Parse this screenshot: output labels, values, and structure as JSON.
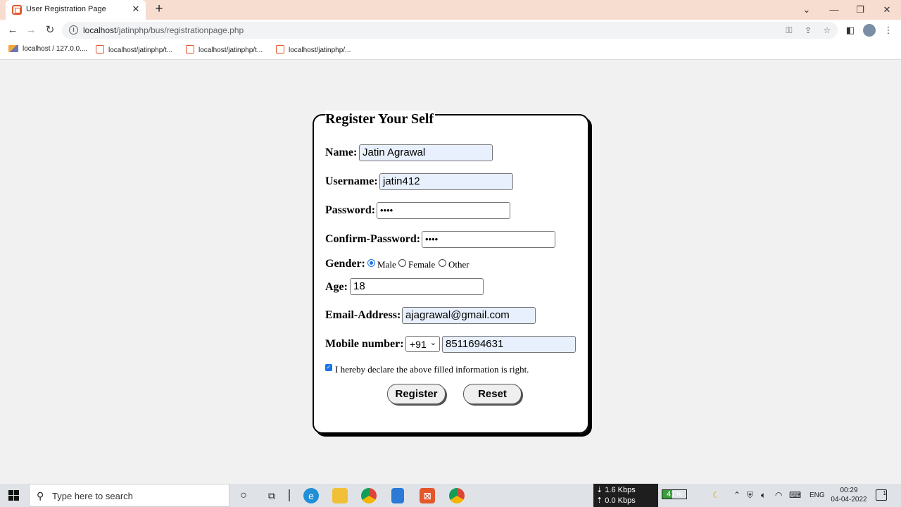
{
  "browser": {
    "tab": {
      "title": "User Registration Page",
      "close": "✕"
    },
    "new_tab": "+",
    "window": {
      "dropdown": "⌄",
      "minimize": "—",
      "restore": "❐",
      "close": "✕"
    },
    "nav": {
      "back": "←",
      "forward": "→",
      "reload": "↻"
    },
    "url": {
      "host": "localhost",
      "path": "/jatinphp/bus/registrationpage.php"
    },
    "bookmarks": [
      {
        "label": "localhost / 127.0.0....",
        "icon": "phpmyadmin-icon"
      },
      {
        "label": "localhost/jatinphp/t...",
        "icon": "xampp-icon"
      },
      {
        "label": "localhost/jatinphp/t...",
        "icon": "xampp-icon"
      },
      {
        "label": "localhost/jatinphp/...",
        "icon": "xampp-icon"
      }
    ]
  },
  "form": {
    "legend": "Register Your Self",
    "name_label": "Name:",
    "name_value": "Jatin Agrawal",
    "username_label": "Username:",
    "username_value": "jatin412",
    "password_label": "Password:",
    "password_value": "••••",
    "confirm_label": "Confirm-Password:",
    "confirm_value": "••••",
    "gender_label": "Gender:",
    "gender_options": [
      "Male",
      "Female",
      "Other"
    ],
    "gender_selected": "Male",
    "age_label": "Age:",
    "age_value": "18",
    "email_label": "Email-Address:",
    "email_value": "ajagrawal@gmail.com",
    "mobile_label": "Mobile number:",
    "country_code": "+91",
    "mobile_value": "8511694631",
    "declaration": "I hereby declare the above filled information is right.",
    "declaration_checked": true,
    "register_button": "Register",
    "reset_button": "Reset"
  },
  "taskbar": {
    "search_placeholder": "Type here to search",
    "network_up": "1.6 Kbps",
    "network_down": "0.0 Kbps",
    "battery_percent": "41%",
    "battery_level": 0.41,
    "language": "ENG",
    "time": "00:29",
    "date": "04-04-2022",
    "notifications": "1"
  },
  "colors": {
    "tabbar": "#f7dcd0",
    "autofill": "#e8f0fe",
    "accent": "#1a73e8",
    "xampp": "#e3572b"
  }
}
